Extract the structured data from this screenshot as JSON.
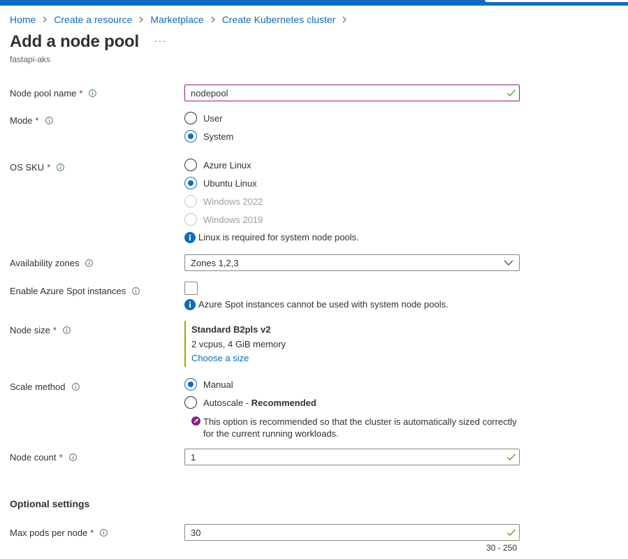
{
  "breadcrumb": {
    "items": [
      "Home",
      "Create a resource",
      "Marketplace",
      "Create Kubernetes cluster"
    ]
  },
  "page": {
    "title": "Add a node pool",
    "subtitle": "fastapi-aks",
    "more_label": "···"
  },
  "form": {
    "node_pool_name": {
      "label": "Node pool name",
      "value": "nodepool"
    },
    "mode": {
      "label": "Mode",
      "options": [
        "User",
        "System"
      ],
      "selected": "System"
    },
    "os_sku": {
      "label": "OS SKU",
      "options": [
        "Azure Linux",
        "Ubuntu Linux",
        "Windows 2022",
        "Windows 2019"
      ],
      "selected": "Ubuntu Linux",
      "note": "Linux is required for system node pools."
    },
    "availability_zones": {
      "label": "Availability zones",
      "value": "Zones 1,2,3"
    },
    "spot": {
      "label": "Enable Azure Spot instances",
      "checked": false,
      "note": "Azure Spot instances cannot be used with system node pools."
    },
    "node_size": {
      "label": "Node size",
      "name": "Standard B2pls v2",
      "spec": "2 vcpus, 4 GiB memory",
      "link": "Choose a size"
    },
    "scale_method": {
      "label": "Scale method",
      "manual": "Manual",
      "autoscale": "Autoscale - ",
      "recommended": "Recommended",
      "selected": "Manual",
      "note_line1": "This option is recommended so that the cluster is automatically sized correctly",
      "note_line2": "for the current running workloads."
    },
    "node_count": {
      "label": "Node count",
      "value": "1"
    },
    "optional_heading": "Optional settings",
    "max_pods": {
      "label": "Max pods per node",
      "value": "30",
      "range": "30 - 250"
    },
    "required_marker": "*"
  },
  "colors": {
    "accent": "#0f6cbd",
    "valid": "#5ba12b",
    "required": "#a4262c",
    "focus_border": "#8a1f8a",
    "size_bar": "#7fba00",
    "recommend_icon": "#8a1f8a"
  },
  "icons": {
    "breadcrumb_separator": "chevron-right-icon",
    "info": "info-icon",
    "valid": "checkmark-icon",
    "dropdown": "chevron-down-icon",
    "note": "info-filled-icon",
    "recommend": "rocket-icon"
  }
}
